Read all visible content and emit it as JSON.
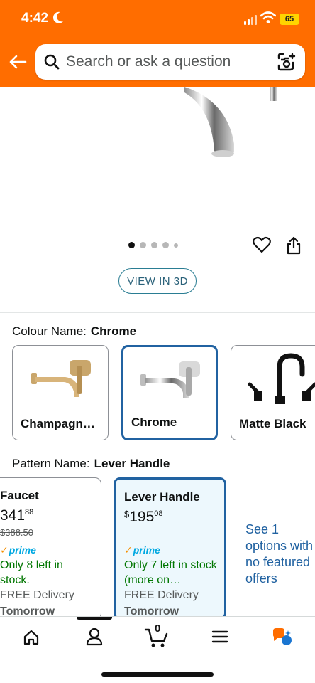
{
  "status": {
    "time": "4:42",
    "battery": "65"
  },
  "search": {
    "placeholder": "Search or ask a question"
  },
  "gallery": {
    "view_3d_label": "VIEW IN 3D"
  },
  "colour": {
    "label": "Colour Name:",
    "selected": "Chrome",
    "options": [
      {
        "name": "Champagn…"
      },
      {
        "name": "Chrome"
      },
      {
        "name": "Matte Black"
      }
    ]
  },
  "pattern": {
    "label": "Pattern Name:",
    "selected": "Lever Handle",
    "cards": [
      {
        "title": "Faucet",
        "price_whole": "341",
        "price_fraction": "88",
        "list_price": "$388.50",
        "prime": "prime",
        "stock": "Only 8 left in stock.",
        "delivery": "FREE Delivery",
        "delivery_day": "Tomorrow"
      },
      {
        "title": "Lever Handle",
        "currency": "$",
        "price_whole": "195",
        "price_fraction": "08",
        "prime": "prime",
        "stock": "Only 7 left in stock (more on…",
        "delivery": "FREE Delivery",
        "delivery_day": "Tomorrow"
      }
    ],
    "other_offers": "See 1 options with no featured offers"
  },
  "nav": {
    "cart_count": "0"
  },
  "colors": {
    "header": "#ff6d00",
    "link": "#2162a1",
    "stock": "#007600",
    "prime": "#00a8e1"
  }
}
